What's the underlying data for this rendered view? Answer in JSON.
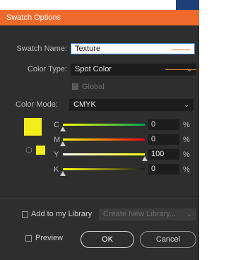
{
  "window": {
    "title": "Swatch Options"
  },
  "swatch_name": {
    "label": "Swatch Name:",
    "value": "Texture"
  },
  "color_type": {
    "label": "Color Type:",
    "value": "Spot Color"
  },
  "global": {
    "label": "Global",
    "checked": true,
    "enabled": false
  },
  "color_mode": {
    "label": "Color Mode:",
    "value": "CMYK"
  },
  "swatch_color": "#f2ee1b",
  "channels": [
    {
      "label": "C",
      "value": "0",
      "unit": "%",
      "fill": 0.0,
      "gradient": "linear-gradient(to right, #ffff00, #00a651)"
    },
    {
      "label": "M",
      "value": "0",
      "unit": "%",
      "fill": 0.0,
      "gradient": "linear-gradient(to right, #ffff00, #ff0000)"
    },
    {
      "label": "Y",
      "value": "100",
      "unit": "%",
      "fill": 1.0,
      "gradient": "linear-gradient(to right, #ffffff, #ffff00)"
    },
    {
      "label": "K",
      "value": "0",
      "unit": "%",
      "fill": 0.0,
      "gradient": "linear-gradient(to right, #ffff00, #1a1a1a)"
    }
  ],
  "library": {
    "label": "Add to my Library",
    "checked": false,
    "placeholder": "Create New Library..."
  },
  "preview": {
    "label": "Preview",
    "checked": false
  },
  "buttons": {
    "ok": "OK",
    "cancel": "Cancel"
  },
  "icons": {
    "chevron": "chevron-down-icon",
    "cube": "cube-icon"
  }
}
